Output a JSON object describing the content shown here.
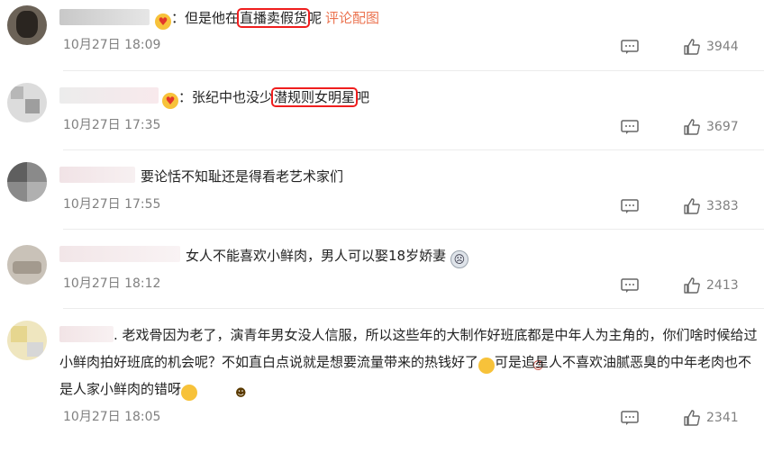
{
  "comments": [
    {
      "segments": {
        "a": "：但是他在",
        "hl": "直播卖假货",
        "b": "呢"
      },
      "link": "评论配图",
      "date": "10月27日 18:09",
      "likes": "3944"
    },
    {
      "segments": {
        "a": "：张纪中也没少",
        "hl": "潜规则女明星",
        "b": "吧"
      },
      "date": "10月27日 17:35",
      "likes": "3697"
    },
    {
      "text": "要论恬不知耻还是得看老艺术家们",
      "date": "10月27日 17:55",
      "likes": "3383"
    },
    {
      "text": "女人不能喜欢小鲜肉，男人可以娶18岁娇妻",
      "date": "10月27日 18:12",
      "likes": "2413"
    },
    {
      "segments": {
        "a": ". 老戏骨因为老了，演青年男女没人信服，所以这些年的大制作好班底都是中年人为主角的，你们啥时候给过小鲜肉拍好班底的机会呢？不如直白点说就是想要流量带来的热钱好了",
        "b": "可是追星人不喜欢油腻恶臭的中年老肉也不是人家小鲜肉的错呀"
      },
      "date": "10月27日 18:05",
      "likes": "2341"
    }
  ],
  "icons": {
    "reply": "comment-icon",
    "like": "thumbs-up-icon"
  },
  "colors": {
    "highlight_box": "#ef1e1e",
    "link": "#eb7350",
    "meta": "#808080"
  }
}
